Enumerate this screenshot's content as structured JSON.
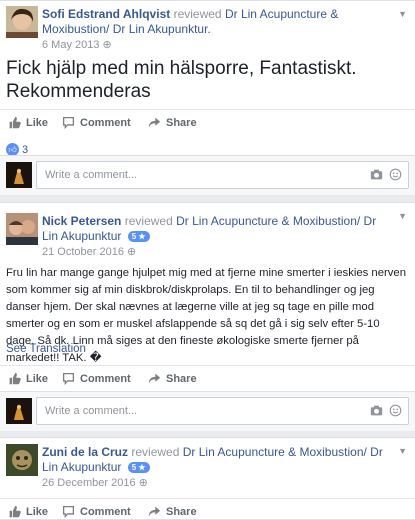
{
  "posts": [
    {
      "name": "Sofi Edstrand Ahlqvist",
      "reviewed": "reviewed",
      "page_name": "Dr Lin Acupuncture & Moxibustion/ Dr Lin Akupunktur.",
      "date": "6 May 2013",
      "text": "Fick hjälp med min hälsporre, Fantastiskt. Rekommenderas",
      "like_count": "3"
    },
    {
      "name": "Nick Petersen",
      "reviewed": "reviewed",
      "page_name": "Dr Lin Acupuncture & Moxibustion/ Dr Lin Akupunktur",
      "rating": "5 ★",
      "date": "21 October 2016",
      "text": "Fru lin har mange gange hjulpet mig med at fjerne mine smerter i ieskies nerven som kommer sig af min diskbrok/diskprolaps. En til to behandlinger og jeg danser hjem. Der skal nævnes at lægerne ville at jeg sq tage en pille mod smerter og en som er muskel afslappende så sq det gå i sig selv efter 5-10 dage. Så dk. Linn må siges at den fineste økologiske smerte fjerner på markedet!! TAK. �",
      "see_translation": "See Translation"
    },
    {
      "name": "Zuni de la Cruz",
      "reviewed": "reviewed",
      "page_name": "Dr Lin Acupuncture & Moxibustion/ Dr Lin Akupunktur",
      "rating": "5 ★",
      "date": "26 December 2016"
    }
  ],
  "actions": {
    "like": "Like",
    "comment": "Comment",
    "share": "Share"
  },
  "comment_placeholder": "Write a comment...",
  "colors": {
    "link": "#365899",
    "accent": "#5890ff",
    "muted": "#90949c"
  }
}
